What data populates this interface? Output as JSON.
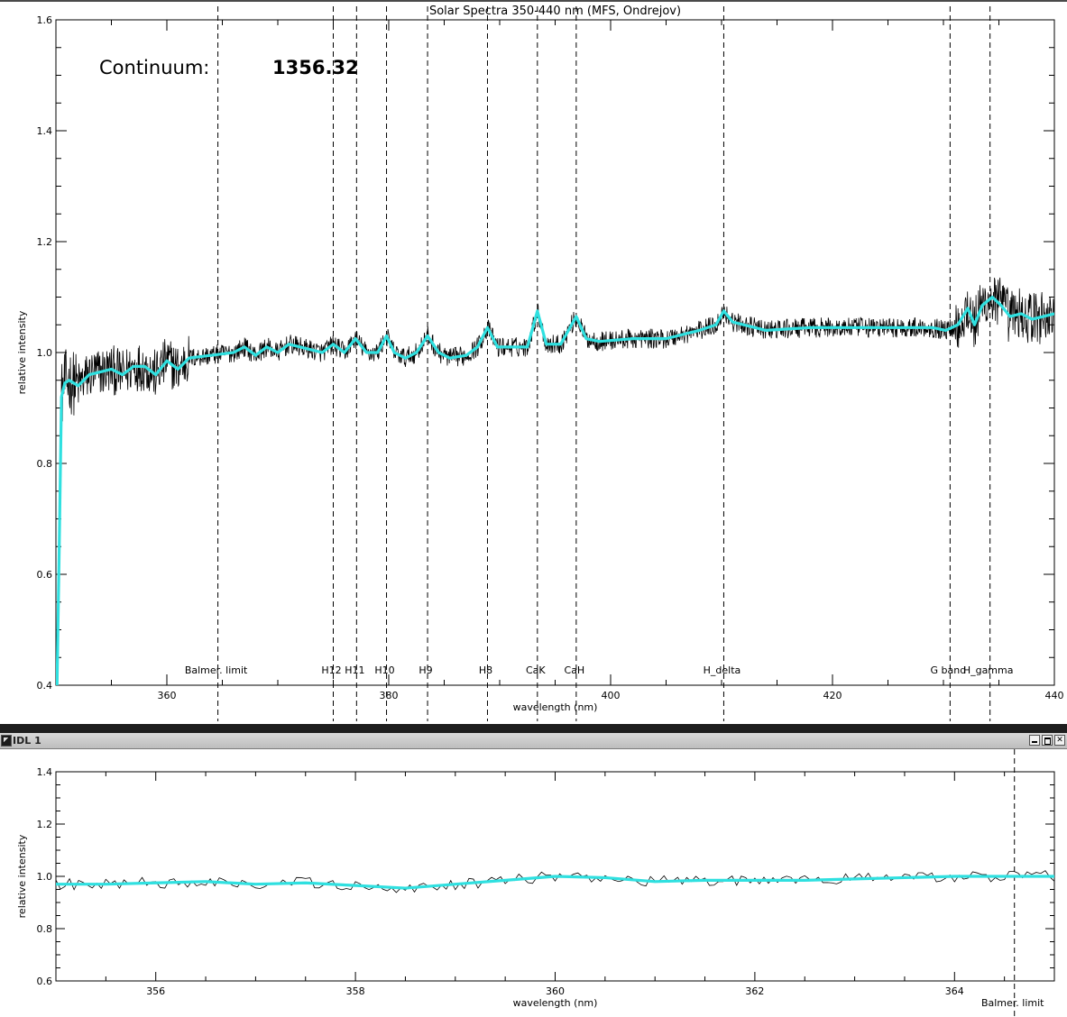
{
  "window_bottom": {
    "title": "IDL 1"
  },
  "colors": {
    "fit": "#2fe0e0",
    "spectrum": "#000000",
    "axes": "#000000",
    "titlebar": "#c8c8c8"
  },
  "chart_data": [
    {
      "type": "line",
      "title": "Solar Spectra 350-440 nm (MFS, Ondrejov)",
      "xlabel": "wavelength (nm)",
      "ylabel": "relative intensity",
      "xlim": [
        350,
        440
      ],
      "ylim": [
        0.4,
        1.6
      ],
      "xticks": [
        360,
        380,
        400,
        420,
        440
      ],
      "yticks": [
        0.4,
        0.6,
        0.8,
        1.0,
        1.2,
        1.4,
        1.6
      ],
      "annotation": {
        "label": "Continuum:",
        "value": "1356.32"
      },
      "lines": [
        {
          "label": "Balmer. limit",
          "x": 364.6
        },
        {
          "label": "H12",
          "x": 375.0
        },
        {
          "label": "H11",
          "x": 377.1
        },
        {
          "label": "H10",
          "x": 379.8
        },
        {
          "label": "H9",
          "x": 383.5
        },
        {
          "label": "H8",
          "x": 388.9
        },
        {
          "label": "CaK",
          "x": 393.4
        },
        {
          "label": "CaH",
          "x": 396.9
        },
        {
          "label": "H_delta",
          "x": 410.2
        },
        {
          "label": "G band",
          "x": 430.6
        },
        {
          "label": "H_gamma",
          "x": 434.2
        }
      ],
      "fit_points": [
        [
          350.1,
          0.4
        ],
        [
          350.3,
          0.65
        ],
        [
          350.5,
          0.92
        ],
        [
          350.8,
          0.945
        ],
        [
          351.2,
          0.95
        ],
        [
          352,
          0.94
        ],
        [
          353,
          0.96
        ],
        [
          354,
          0.965
        ],
        [
          355,
          0.97
        ],
        [
          356,
          0.96
        ],
        [
          357,
          0.975
        ],
        [
          358,
          0.975
        ],
        [
          359,
          0.96
        ],
        [
          360,
          0.985
        ],
        [
          361,
          0.97
        ],
        [
          362,
          0.99
        ],
        [
          364,
          0.995
        ],
        [
          366,
          1.0
        ],
        [
          367,
          1.01
        ],
        [
          368,
          0.995
        ],
        [
          369,
          1.01
        ],
        [
          370,
          1.0
        ],
        [
          371,
          1.015
        ],
        [
          372,
          1.01
        ],
        [
          373,
          1.005
        ],
        [
          374,
          1.0
        ],
        [
          375,
          1.015
        ],
        [
          376,
          1.0
        ],
        [
          377,
          1.025
        ],
        [
          378,
          1.0
        ],
        [
          379,
          1.0
        ],
        [
          379.8,
          1.03
        ],
        [
          380.5,
          1.0
        ],
        [
          381.5,
          0.99
        ],
        [
          382.5,
          1.0
        ],
        [
          383.5,
          1.03
        ],
        [
          384.5,
          1.0
        ],
        [
          385.5,
          0.99
        ],
        [
          387,
          0.995
        ],
        [
          388,
          1.01
        ],
        [
          388.9,
          1.045
        ],
        [
          389.8,
          1.01
        ],
        [
          391,
          1.01
        ],
        [
          392.5,
          1.01
        ],
        [
          393.4,
          1.075
        ],
        [
          394.2,
          1.015
        ],
        [
          395.5,
          1.015
        ],
        [
          396.9,
          1.065
        ],
        [
          397.8,
          1.025
        ],
        [
          399,
          1.02
        ],
        [
          402,
          1.025
        ],
        [
          405,
          1.025
        ],
        [
          408,
          1.04
        ],
        [
          409.5,
          1.05
        ],
        [
          410.2,
          1.075
        ],
        [
          411,
          1.055
        ],
        [
          414,
          1.04
        ],
        [
          418,
          1.045
        ],
        [
          422,
          1.045
        ],
        [
          426,
          1.045
        ],
        [
          429,
          1.045
        ],
        [
          430.2,
          1.04
        ],
        [
          431.3,
          1.05
        ],
        [
          432.2,
          1.08
        ],
        [
          432.8,
          1.05
        ],
        [
          433.5,
          1.085
        ],
        [
          434.4,
          1.1
        ],
        [
          435.2,
          1.085
        ],
        [
          436,
          1.065
        ],
        [
          437,
          1.07
        ],
        [
          438,
          1.06
        ],
        [
          439,
          1.065
        ],
        [
          440,
          1.07
        ]
      ]
    },
    {
      "type": "line",
      "title": "",
      "xlabel": "wavelength (nm)",
      "ylabel": "relative intensity",
      "xlim": [
        355,
        365
      ],
      "ylim": [
        0.6,
        1.4
      ],
      "xticks": [
        356,
        358,
        360,
        362,
        364
      ],
      "yticks": [
        0.6,
        0.8,
        1.0,
        1.2,
        1.4
      ],
      "lines": [
        {
          "label": "Balmer. limit",
          "x": 364.6
        }
      ],
      "fit_points": [
        [
          355,
          0.97
        ],
        [
          355.5,
          0.97
        ],
        [
          356,
          0.975
        ],
        [
          356.5,
          0.98
        ],
        [
          357,
          0.97
        ],
        [
          357.5,
          0.975
        ],
        [
          358,
          0.965
        ],
        [
          358.5,
          0.955
        ],
        [
          359,
          0.97
        ],
        [
          359.5,
          0.985
        ],
        [
          360,
          1.0
        ],
        [
          360.5,
          0.995
        ],
        [
          361,
          0.98
        ],
        [
          361.5,
          0.985
        ],
        [
          362,
          0.985
        ],
        [
          362.5,
          0.985
        ],
        [
          363,
          0.99
        ],
        [
          363.5,
          0.995
        ],
        [
          364,
          1.0
        ],
        [
          364.5,
          1.0
        ],
        [
          365,
          1.0
        ]
      ]
    }
  ]
}
